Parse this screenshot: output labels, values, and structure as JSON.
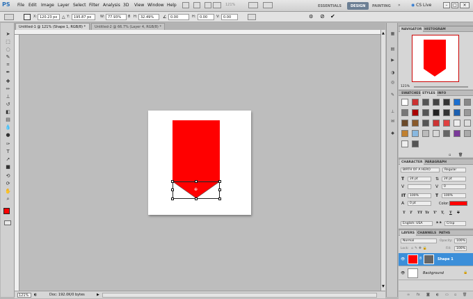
{
  "app": {
    "logo": "PS"
  },
  "menu": [
    "File",
    "Edit",
    "Image",
    "Layer",
    "Select",
    "Filter",
    "Analysis",
    "3D",
    "View",
    "Window",
    "Help"
  ],
  "zoom_dropdown": "121%",
  "workspaces": {
    "essentials": "ESSENTIALS",
    "design": "DESIGN",
    "painting": "PAINTING",
    "more": "»",
    "cslive": "CS Live"
  },
  "options": {
    "x_label": "X:",
    "x_value": "120.23 px",
    "y_label": "Y:",
    "y_value": "195.87 px",
    "w_label": "W:",
    "w_value": "77.93%",
    "h_label": "H:",
    "h_value": "32.49%",
    "angle_value": "0.00",
    "hskew_label": "H:",
    "hskew_value": "0.00",
    "vskew_label": "V:",
    "vskew_value": "0.00"
  },
  "tabs": [
    {
      "label": "Untitled-1 @ 121% (Shape 1, RGB/8) *",
      "close": "×"
    },
    {
      "label": "Untitled-2 @ 66.7% (Layer 4, RGB/8) *",
      "close": "×"
    }
  ],
  "status": {
    "zoom": "121%",
    "doc": "Doc: 192.0K/0 bytes"
  },
  "navigator": {
    "tabs": [
      "NAVIGATOR",
      "HISTOGRAM"
    ],
    "zoom": "121%"
  },
  "styles_panel": {
    "tabs": [
      "SWATCHES",
      "STYLES",
      "INFO"
    ]
  },
  "character": {
    "tabs": [
      "CHARACTER",
      "PARAGRAPH"
    ],
    "font": "BIRTH OF A HERO",
    "style": "Regular",
    "size": "24 pt",
    "leading": "24 pt",
    "tracking": "0",
    "vscale": "100%",
    "hscale": "100%",
    "baseline": "0 pt",
    "color_label": "Color:",
    "type_styles": [
      "T",
      "T",
      "TT",
      "Tr",
      "T'",
      "T,",
      "T",
      "T"
    ],
    "language": "English: USA",
    "aa_label": "a a",
    "aa": "Crisp"
  },
  "layers": {
    "tabs": [
      "LAYERS",
      "CHANNELS",
      "PATHS"
    ],
    "blend": "Normal",
    "opacity_label": "Opacity:",
    "opacity": "100%",
    "lock_label": "Lock:",
    "fill_label": "Fill:",
    "fill": "100%",
    "items": [
      {
        "name": "Shape 1",
        "selected": true
      },
      {
        "name": "Background",
        "selected": false
      }
    ]
  },
  "colors": {
    "accent": "#3c8fd9",
    "shape_red": "#ff0000",
    "design_tab": "#6c7f94"
  }
}
